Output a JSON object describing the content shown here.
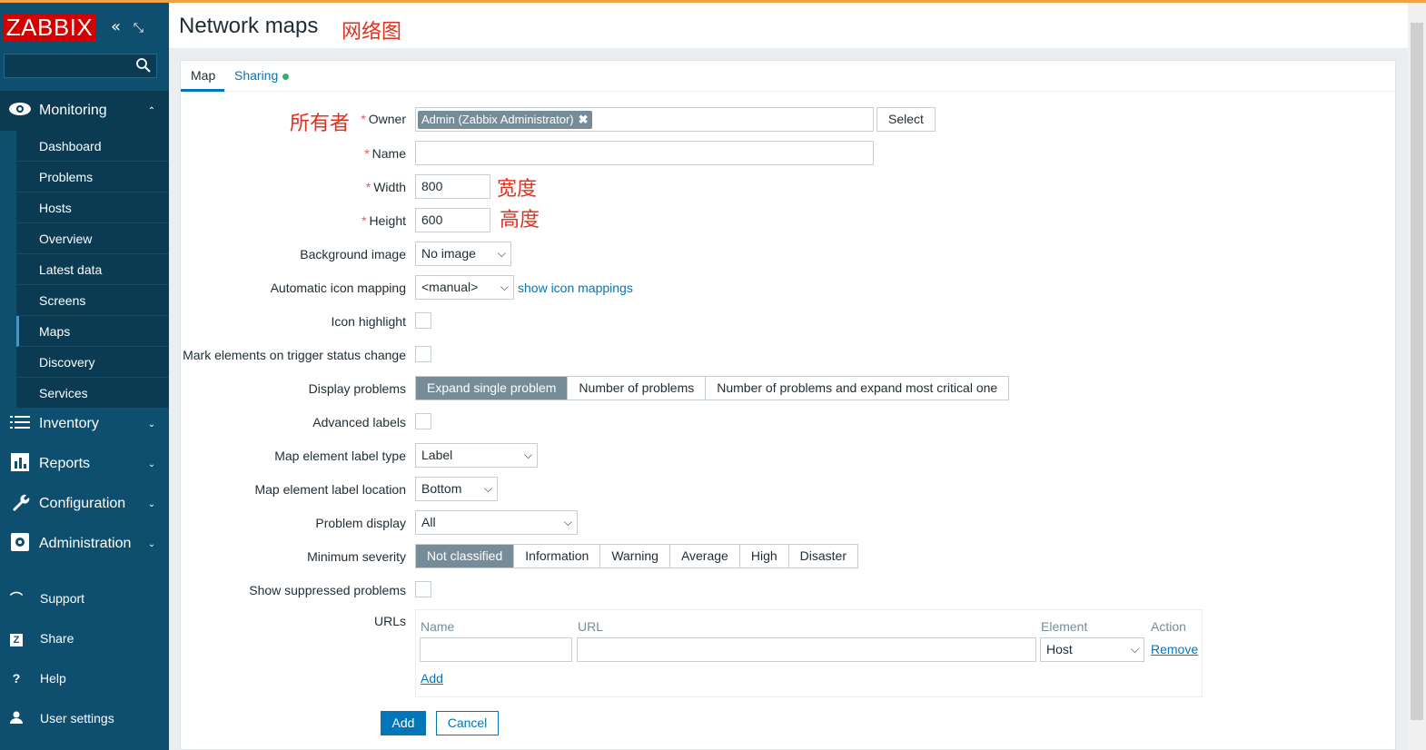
{
  "app": {
    "logo": "ZABBIX"
  },
  "sidebar": {
    "search_placeholder": "",
    "monitoring": {
      "label": "Monitoring",
      "items": [
        "Dashboard",
        "Problems",
        "Hosts",
        "Overview",
        "Latest data",
        "Screens",
        "Maps",
        "Discovery",
        "Services"
      ],
      "active": "Maps"
    },
    "sections": [
      "Inventory",
      "Reports",
      "Configuration",
      "Administration"
    ],
    "bottom": [
      "Support",
      "Share",
      "Help",
      "User settings"
    ]
  },
  "header": {
    "title": "Network maps",
    "annotation": "网络图"
  },
  "tabs": {
    "map": "Map",
    "sharing": "Sharing"
  },
  "form": {
    "owner": {
      "label": "Owner",
      "value": "Admin (Zabbix Administrator)",
      "select_btn": "Select",
      "annotation": "所有者"
    },
    "name": {
      "label": "Name",
      "value": ""
    },
    "width": {
      "label": "Width",
      "value": "800",
      "annotation": "宽度"
    },
    "height": {
      "label": "Height",
      "value": "600",
      "annotation": "高度"
    },
    "background_image": {
      "label": "Background image",
      "value": "No image"
    },
    "icon_mapping": {
      "label": "Automatic icon mapping",
      "value": "<manual>",
      "link": "show icon mappings"
    },
    "icon_highlight": {
      "label": "Icon highlight"
    },
    "mark_elements": {
      "label": "Mark elements on trigger status change"
    },
    "display_problems": {
      "label": "Display problems",
      "options": [
        "Expand single problem",
        "Number of problems",
        "Number of problems and expand most critical one"
      ],
      "selected": "Expand single problem"
    },
    "advanced_labels": {
      "label": "Advanced labels"
    },
    "label_type": {
      "label": "Map element label type",
      "value": "Label"
    },
    "label_location": {
      "label": "Map element label location",
      "value": "Bottom"
    },
    "problem_display": {
      "label": "Problem display",
      "value": "All"
    },
    "min_severity": {
      "label": "Minimum severity",
      "options": [
        "Not classified",
        "Information",
        "Warning",
        "Average",
        "High",
        "Disaster"
      ],
      "selected": "Not classified"
    },
    "show_suppressed": {
      "label": "Show suppressed problems"
    },
    "urls": {
      "label": "URLs",
      "headers": {
        "name": "Name",
        "url": "URL",
        "element": "Element",
        "action": "Action"
      },
      "row": {
        "name": "",
        "url": "",
        "element": "Host",
        "action": "Remove"
      },
      "add": "Add"
    },
    "buttons": {
      "add": "Add",
      "cancel": "Cancel"
    }
  }
}
